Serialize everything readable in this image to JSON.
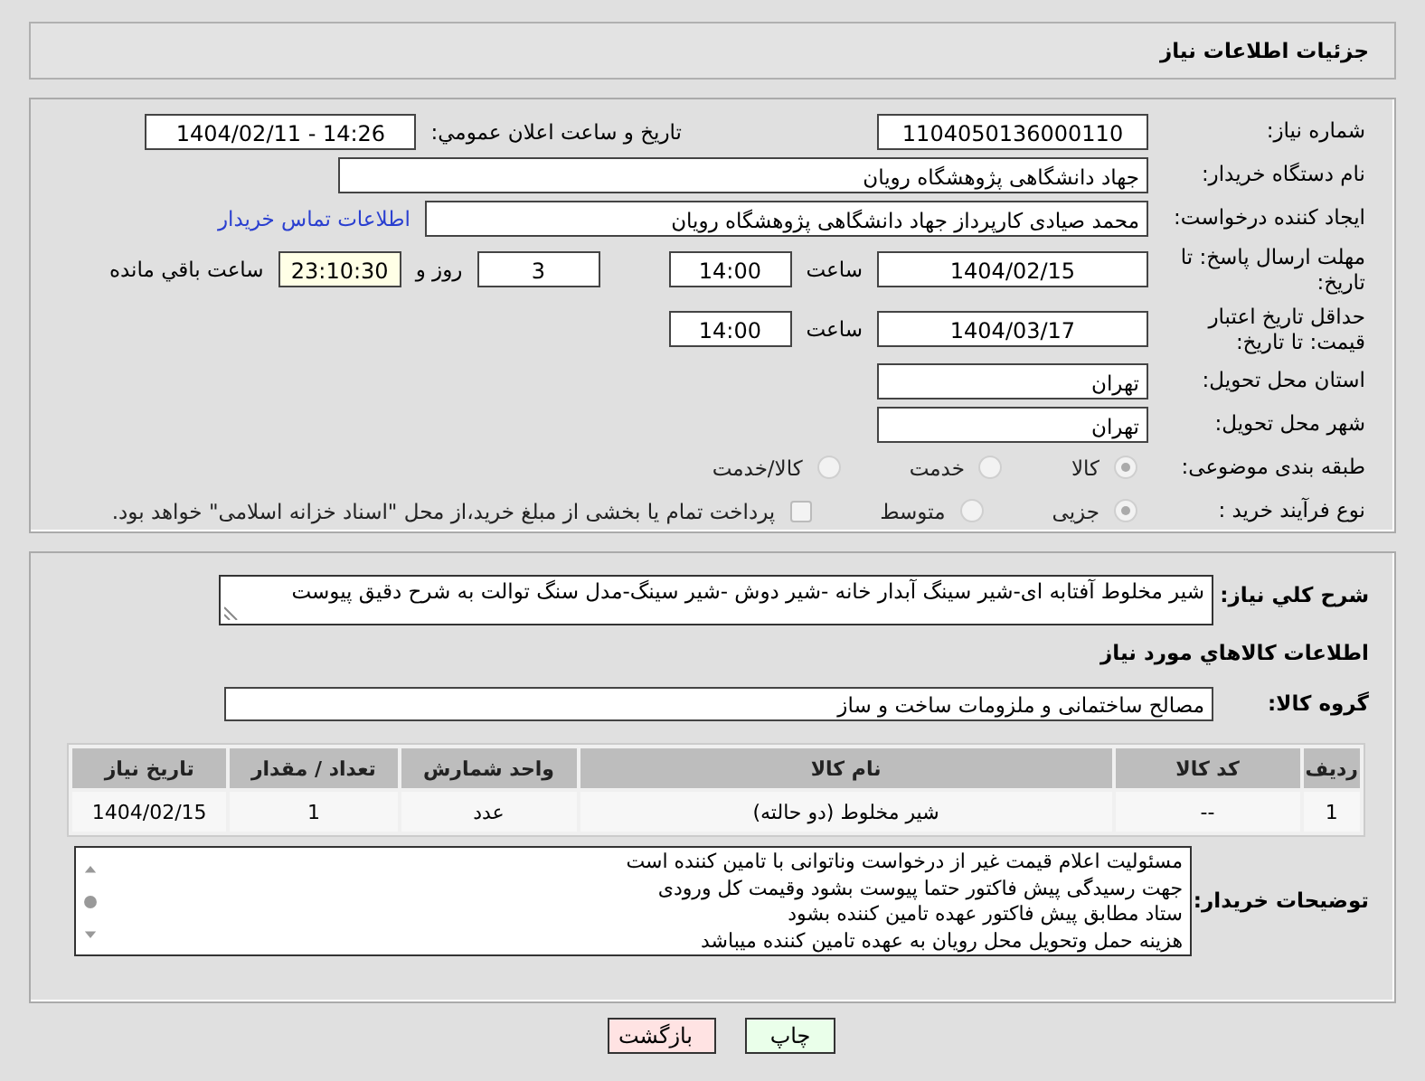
{
  "header": {
    "title": "جزئیات اطلاعات نیاز"
  },
  "need_number": {
    "label": "شماره نیاز:",
    "value": "1104050136000110"
  },
  "announce": {
    "label": "تاریخ و ساعت اعلان عمومي:",
    "value": "1404/02/11 - 14:26"
  },
  "buyer_org": {
    "label": "نام دستگاه خریدار:",
    "value": "جهاد دانشگاهی پژوهشگاه رویان"
  },
  "requester": {
    "label": "ایجاد کننده درخواست:",
    "value": "محمد صیادی کارپرداز جهاد دانشگاهی پژوهشگاه رویان",
    "link": "اطلاعات تماس خریدار"
  },
  "deadline": {
    "label": "مهلت ارسال پاسخ: تا تاریخ:",
    "date": "1404/02/15",
    "time_label": "ساعت",
    "time": "14:00",
    "days": "3",
    "days_label": "روز و",
    "remaining": "23:10:30",
    "remaining_label": "ساعت باقي مانده"
  },
  "validity": {
    "label": "حداقل تاریخ اعتبار قیمت: تا تاریخ:",
    "date": "1404/03/17",
    "time_label": "ساعت",
    "time": "14:00"
  },
  "province": {
    "label": "استان محل تحویل:",
    "value": "تهران"
  },
  "city": {
    "label": "شهر محل تحویل:",
    "value": "تهران"
  },
  "category": {
    "label": "طبقه بندی موضوعی:",
    "options": [
      {
        "label": "کالا",
        "selected": true
      },
      {
        "label": "خدمت",
        "selected": false
      },
      {
        "label": "کالا/خدمت",
        "selected": false
      }
    ]
  },
  "process": {
    "label": "نوع فرآیند خرید :",
    "options": [
      {
        "label": "جزیی",
        "selected": true
      },
      {
        "label": "متوسط",
        "selected": false
      }
    ],
    "treasury": {
      "checked": false,
      "label": "پرداخت تمام یا بخشی از مبلغ خرید،از محل \"اسناد خزانه اسلامی\" خواهد بود."
    }
  },
  "description": {
    "label": "شرح کلي نیاز:",
    "value": "شیر مخلوط آفتابه ای-شیر سینگ آبدار خانه -شیر دوش -شیر سینگ-مدل سنگ توالت به شرح دقیق پیوست"
  },
  "goods_heading": "اطلاعات کالاهاي مورد نیاز",
  "goods_group": {
    "label": "گروه کالا:",
    "value": "مصالح ساختمانی و ملزومات ساخت و ساز"
  },
  "table": {
    "columns": [
      "ردیف",
      "کد کالا",
      "نام کالا",
      "واحد شمارش",
      "تعداد / مقدار",
      "تاریخ نیاز"
    ],
    "rows": [
      [
        "1",
        "--",
        "شیر مخلوط (دو حالته)",
        "عدد",
        "1",
        "1404/02/15"
      ]
    ]
  },
  "buyer_notes": {
    "label": "توضیحات خریدار:",
    "value": "مسئولیت اعلام قیمت  غیر از درخواست وناتوانی با تامین کننده است\nجهت رسیدگی پیش فاکتور حتما پیوست بشود وقیمت کل ورودی\nستاد مطابق پیش فاکتور عهده تامین کننده بشود\nهزینه حمل وتحویل محل رویان به عهده تامین کننده میباشد"
  },
  "buttons": [
    {
      "label": "چاپ",
      "kind": "print"
    },
    {
      "label": "بازگشت",
      "kind": "back"
    }
  ]
}
